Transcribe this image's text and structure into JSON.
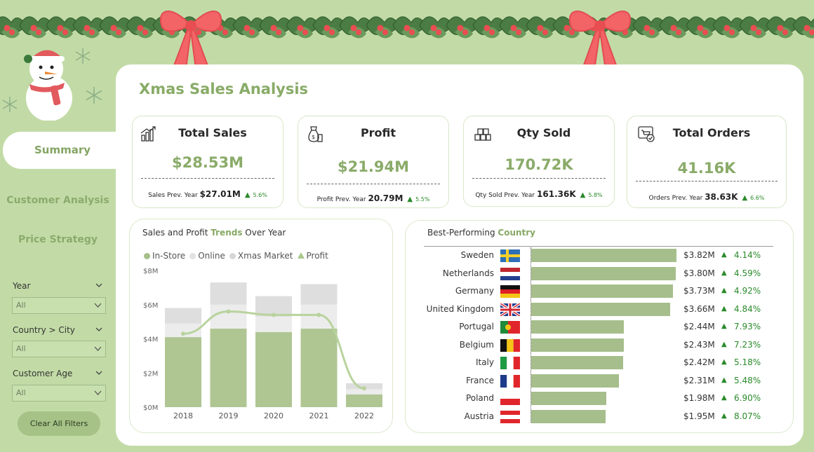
{
  "page_title": "Xmas Sales Analysis",
  "colors": {
    "background": "#c2dba6",
    "accent": "#88ab67",
    "bar": "#a6be8b",
    "positive": "#2a8a2a"
  },
  "nav": {
    "summary": "Summary",
    "customer_analysis": "Customer Analysis",
    "price_strategy": "Price Strategy"
  },
  "filters": [
    {
      "label": "Year",
      "value": "All"
    },
    {
      "label": "Country > City",
      "value": "All"
    },
    {
      "label": "Customer Age",
      "value": "All"
    }
  ],
  "clear_button": "Clear All Filters",
  "kpis": [
    {
      "title": "Total Sales",
      "value": "$28.53M",
      "prev_label": "Sales Prev. Year",
      "prev_value": "$27.01M",
      "change": "5.6%",
      "icon": "bar-chart-icon"
    },
    {
      "title": "Profit",
      "value": "$21.94M",
      "prev_label": "Profit Prev. Year",
      "prev_value": "20.79M",
      "change": "5.5%",
      "icon": "money-bag-icon"
    },
    {
      "title": "Qty Sold",
      "value": "170.72K",
      "prev_label": "Qty Sold Prev. Year",
      "prev_value": "161.36K",
      "change": "5.8%",
      "icon": "boxes-icon"
    },
    {
      "title": "Total Orders",
      "value": "41.16K",
      "prev_label": "Orders Prev. Year",
      "prev_value": "38.63K",
      "change": "6.6%",
      "icon": "shopping-cart-icon"
    }
  ],
  "trend_panel": {
    "title_pre": "Sales and Profit ",
    "title_hl": "Trends",
    "title_post": " Over Year"
  },
  "country_panel": {
    "title_pre": "Best-Performing ",
    "title_hl": "Country"
  },
  "chart_data": [
    {
      "type": "bar",
      "stacked": true,
      "title": "Sales and Profit Trends Over Year",
      "categories": [
        "2018",
        "2019",
        "2020",
        "2021",
        "2022"
      ],
      "ylim": [
        0,
        8
      ],
      "yticks": [
        "$0M",
        "$2M",
        "$4M",
        "$6M",
        "$8M"
      ],
      "series": [
        {
          "name": "In-Store",
          "values": [
            4.1,
            4.6,
            4.4,
            4.6,
            0.75
          ],
          "color": "#afc693"
        },
        {
          "name": "Online",
          "values": [
            0.8,
            1.4,
            0.9,
            1.4,
            0.3
          ],
          "color": "#ececec"
        },
        {
          "name": "Xmas Market",
          "values": [
            0.9,
            1.3,
            1.2,
            1.2,
            0.35
          ],
          "color": "#dedede"
        }
      ],
      "line_series": {
        "name": "Profit",
        "values": [
          4.3,
          5.6,
          5.4,
          5.4,
          1.1
        ],
        "color": "#b8d39d"
      },
      "legend": "top-left"
    },
    {
      "type": "bar",
      "orientation": "horizontal",
      "title": "Best-Performing Country",
      "categories": [
        "Sweden",
        "Netherlands",
        "Germany",
        "United Kingdom",
        "Portugal",
        "Belgium",
        "Italy",
        "France",
        "Poland",
        "Austria"
      ],
      "values": [
        3.82,
        3.8,
        3.73,
        3.66,
        2.44,
        2.43,
        2.42,
        2.31,
        1.98,
        1.95
      ],
      "labels": [
        "$3.82M",
        "$3.80M",
        "$3.73M",
        "$3.66M",
        "$2.44M",
        "$2.43M",
        "$2.42M",
        "$2.31M",
        "$1.98M",
        "$1.95M"
      ],
      "changes": [
        "4.14%",
        "4.59%",
        "4.92%",
        "4.84%",
        "7.93%",
        "7.23%",
        "5.18%",
        "5.48%",
        "6.90%",
        "8.07%"
      ],
      "xlim": [
        0,
        3.82
      ]
    }
  ]
}
